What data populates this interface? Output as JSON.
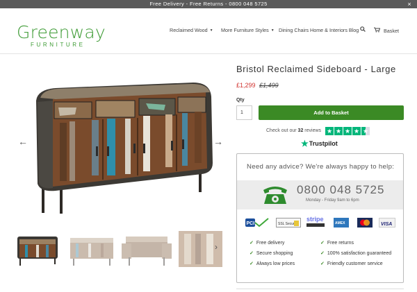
{
  "topbar": {
    "message": "Free Delivery - Free Returns - 0800 048 5725",
    "close": "×"
  },
  "logo": {
    "line1": "Greenway",
    "line2": "FURNITURE"
  },
  "nav": [
    {
      "label": "Reclaimed Wood",
      "dropdown": true
    },
    {
      "label": "More Furniture Styles",
      "dropdown": true
    },
    {
      "label": "Dining Chairs",
      "dropdown": false
    },
    {
      "label": "Home & Interiors Blog",
      "dropdown": false
    }
  ],
  "cart": {
    "label": "Basket",
    "icon": "basket-icon"
  },
  "search": {
    "icon": "search-icon"
  },
  "gallery": {
    "prev": "←",
    "next": "→",
    "thumb_next": "›"
  },
  "product": {
    "title": "Bristol Reclaimed Sideboard - Large",
    "price_now": "£1,299",
    "price_was": "£1,499",
    "qty_label": "Qty",
    "qty_value": "1",
    "add_button": "Add to Basket"
  },
  "reviews": {
    "prefix": "Check out our",
    "count": "32",
    "suffix": "reviews",
    "rating": 4.5,
    "brand": "Trustpilot"
  },
  "advice": {
    "title": "Need any advice? We're always happy to help:",
    "phone": "0800 048 5725",
    "hours": "Monday - Friday 9am to 6pm",
    "payments": [
      "PCI DSS",
      "SSL Secure",
      "stripe",
      "AMEX",
      "Mastercard",
      "VISA"
    ],
    "features": [
      "Free delivery",
      "Free returns",
      "Secure shopping",
      "100% satisfaction guaranteed",
      "Always low prices",
      "Friendly customer service"
    ]
  },
  "colors": {
    "brand": "#3e9b35",
    "button": "#3b8a25",
    "price": "#d0312d",
    "trustpilot": "#00b67a"
  }
}
